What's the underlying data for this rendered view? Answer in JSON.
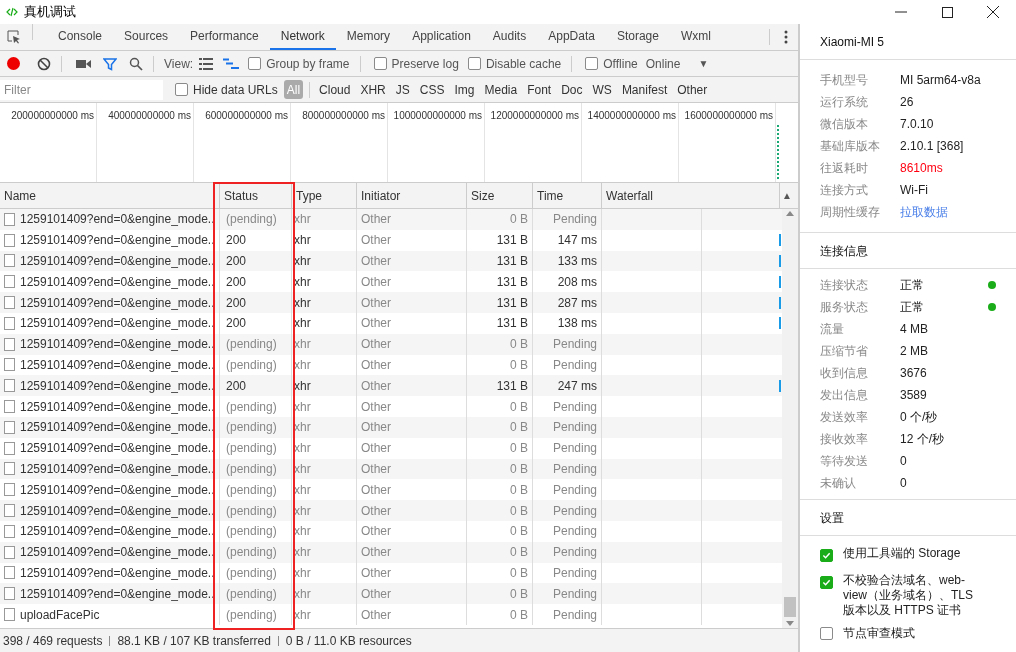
{
  "window": {
    "title": "真机调试"
  },
  "tabs": [
    {
      "label": "Console",
      "selected": false
    },
    {
      "label": "Sources",
      "selected": false
    },
    {
      "label": "Performance",
      "selected": false
    },
    {
      "label": "Network",
      "selected": true
    },
    {
      "label": "Memory",
      "selected": false
    },
    {
      "label": "Application",
      "selected": false
    },
    {
      "label": "Audits",
      "selected": false
    },
    {
      "label": "AppData",
      "selected": false
    },
    {
      "label": "Storage",
      "selected": false
    },
    {
      "label": "Wxml",
      "selected": false
    }
  ],
  "toolbar": {
    "recording": true,
    "filter_on": true,
    "view_label": "View:",
    "large_rows": false,
    "overview": true,
    "options": [
      {
        "label": "Group by frame",
        "checked": false
      },
      {
        "label": "Preserve log",
        "checked": false
      },
      {
        "label": "Disable cache",
        "checked": false
      },
      {
        "label": "Offline",
        "checked": false
      }
    ],
    "throttle": "Online",
    "throttle_caret": "▼"
  },
  "filter_bar": {
    "placeholder": "Filter",
    "hide_data_urls": {
      "label": "Hide data URLs",
      "checked": false
    },
    "types": [
      {
        "label": "All",
        "selected": true
      },
      {
        "label": "Cloud",
        "selected": false
      },
      {
        "label": "XHR",
        "selected": false
      },
      {
        "label": "JS",
        "selected": false
      },
      {
        "label": "CSS",
        "selected": false
      },
      {
        "label": "Img",
        "selected": false
      },
      {
        "label": "Media",
        "selected": false
      },
      {
        "label": "Font",
        "selected": false
      },
      {
        "label": "Doc",
        "selected": false
      },
      {
        "label": "WS",
        "selected": false
      },
      {
        "label": "Manifest",
        "selected": false
      },
      {
        "label": "Other",
        "selected": false
      }
    ]
  },
  "overview": {
    "ticks": [
      "200000000000 ms",
      "400000000000 ms",
      "600000000000 ms",
      "800000000000 ms",
      "1000000000000 ms",
      "1200000000000 ms",
      "1400000000000 ms",
      "1600000000000 ms"
    ]
  },
  "table": {
    "columns": [
      "Name",
      "Status",
      "Type",
      "Initiator",
      "Size",
      "Time",
      "Waterfall"
    ],
    "sort_arrow": "▲",
    "rows": [
      {
        "name": "1259101409?end=0&engine_mode..",
        "status": "(pending)",
        "type": "xhr",
        "initiator": "Other",
        "size": "0 B",
        "time": "Pending",
        "pending": true
      },
      {
        "name": "1259101409?end=0&engine_mode..",
        "status": "200",
        "type": "xhr",
        "initiator": "Other",
        "size": "131 B",
        "time": "147 ms",
        "pending": false
      },
      {
        "name": "1259101409?end=0&engine_mode..",
        "status": "200",
        "type": "xhr",
        "initiator": "Other",
        "size": "131 B",
        "time": "133 ms",
        "pending": false
      },
      {
        "name": "1259101409?end=0&engine_mode..",
        "status": "200",
        "type": "xhr",
        "initiator": "Other",
        "size": "131 B",
        "time": "208 ms",
        "pending": false
      },
      {
        "name": "1259101409?end=0&engine_mode..",
        "status": "200",
        "type": "xhr",
        "initiator": "Other",
        "size": "131 B",
        "time": "287 ms",
        "pending": false
      },
      {
        "name": "1259101409?end=0&engine_mode..",
        "status": "200",
        "type": "xhr",
        "initiator": "Other",
        "size": "131 B",
        "time": "138 ms",
        "pending": false
      },
      {
        "name": "1259101409?end=0&engine_mode..",
        "status": "(pending)",
        "type": "xhr",
        "initiator": "Other",
        "size": "0 B",
        "time": "Pending",
        "pending": true
      },
      {
        "name": "1259101409?end=0&engine_mode..",
        "status": "(pending)",
        "type": "xhr",
        "initiator": "Other",
        "size": "0 B",
        "time": "Pending",
        "pending": true
      },
      {
        "name": "1259101409?end=0&engine_mode..",
        "status": "200",
        "type": "xhr",
        "initiator": "Other",
        "size": "131 B",
        "time": "247 ms",
        "pending": false
      },
      {
        "name": "1259101409?end=0&engine_mode..",
        "status": "(pending)",
        "type": "xhr",
        "initiator": "Other",
        "size": "0 B",
        "time": "Pending",
        "pending": true
      },
      {
        "name": "1259101409?end=0&engine_mode..",
        "status": "(pending)",
        "type": "xhr",
        "initiator": "Other",
        "size": "0 B",
        "time": "Pending",
        "pending": true
      },
      {
        "name": "1259101409?end=0&engine_mode..",
        "status": "(pending)",
        "type": "xhr",
        "initiator": "Other",
        "size": "0 B",
        "time": "Pending",
        "pending": true
      },
      {
        "name": "1259101409?end=0&engine_mode..",
        "status": "(pending)",
        "type": "xhr",
        "initiator": "Other",
        "size": "0 B",
        "time": "Pending",
        "pending": true
      },
      {
        "name": "1259101409?end=0&engine_mode..",
        "status": "(pending)",
        "type": "xhr",
        "initiator": "Other",
        "size": "0 B",
        "time": "Pending",
        "pending": true
      },
      {
        "name": "1259101409?end=0&engine_mode..",
        "status": "(pending)",
        "type": "xhr",
        "initiator": "Other",
        "size": "0 B",
        "time": "Pending",
        "pending": true
      },
      {
        "name": "1259101409?end=0&engine_mode..",
        "status": "(pending)",
        "type": "xhr",
        "initiator": "Other",
        "size": "0 B",
        "time": "Pending",
        "pending": true
      },
      {
        "name": "1259101409?end=0&engine_mode..",
        "status": "(pending)",
        "type": "xhr",
        "initiator": "Other",
        "size": "0 B",
        "time": "Pending",
        "pending": true
      },
      {
        "name": "1259101409?end=0&engine_mode..",
        "status": "(pending)",
        "type": "xhr",
        "initiator": "Other",
        "size": "0 B",
        "time": "Pending",
        "pending": true
      },
      {
        "name": "1259101409?end=0&engine_mode..",
        "status": "(pending)",
        "type": "xhr",
        "initiator": "Other",
        "size": "0 B",
        "time": "Pending",
        "pending": true
      },
      {
        "name": "uploadFacePic",
        "status": "(pending)",
        "type": "xhr",
        "initiator": "Other",
        "size": "0 B",
        "time": "Pending",
        "pending": true
      }
    ]
  },
  "status_bar": [
    "398 / 469 requests",
    "88.1 KB / 107 KB transferred",
    "0 B / 11.0 KB resources"
  ],
  "side_panel": {
    "device": "Xiaomi-MI 5",
    "info": [
      {
        "label": "手机型号",
        "value": "MI 5arm64-v8a",
        "kind": "text"
      },
      {
        "label": "运行系统",
        "value": "26",
        "kind": "text"
      },
      {
        "label": "微信版本",
        "value": "7.0.10",
        "kind": "text"
      },
      {
        "label": "基础库版本",
        "value": "2.10.1 [368]",
        "kind": "text"
      },
      {
        "label": "往返耗时",
        "value": "8610ms",
        "kind": "alert"
      },
      {
        "label": "连接方式",
        "value": "Wi-Fi",
        "kind": "text"
      },
      {
        "label": "周期性缓存",
        "value": "拉取数据",
        "kind": "link"
      }
    ],
    "connection_title": "连接信息",
    "connection": [
      {
        "label": "连接状态",
        "value": "正常",
        "color": "#1aad19"
      },
      {
        "label": "服务状态",
        "value": "正常",
        "color": "#1aad19"
      },
      {
        "label": "流量",
        "value": "4 MB"
      },
      {
        "label": "压缩节省",
        "value": "2 MB"
      },
      {
        "label": "收到信息",
        "value": "3676"
      },
      {
        "label": "发出信息",
        "value": "3589"
      },
      {
        "label": "发送效率",
        "value": "0 个/秒"
      },
      {
        "label": "接收效率",
        "value": "12 个/秒"
      },
      {
        "label": "等待发送",
        "value": "0"
      },
      {
        "label": "未确认",
        "value": "0"
      }
    ],
    "settings_title": "设置",
    "settings": [
      {
        "label": "使用工具端的 Storage",
        "checked": true
      },
      {
        "label": "不校验合法域名、web-view（业务域名）、TLS 版本以及 HTTPS 证书",
        "checked": true
      },
      {
        "label": "节点审查模式",
        "checked": false
      }
    ]
  }
}
